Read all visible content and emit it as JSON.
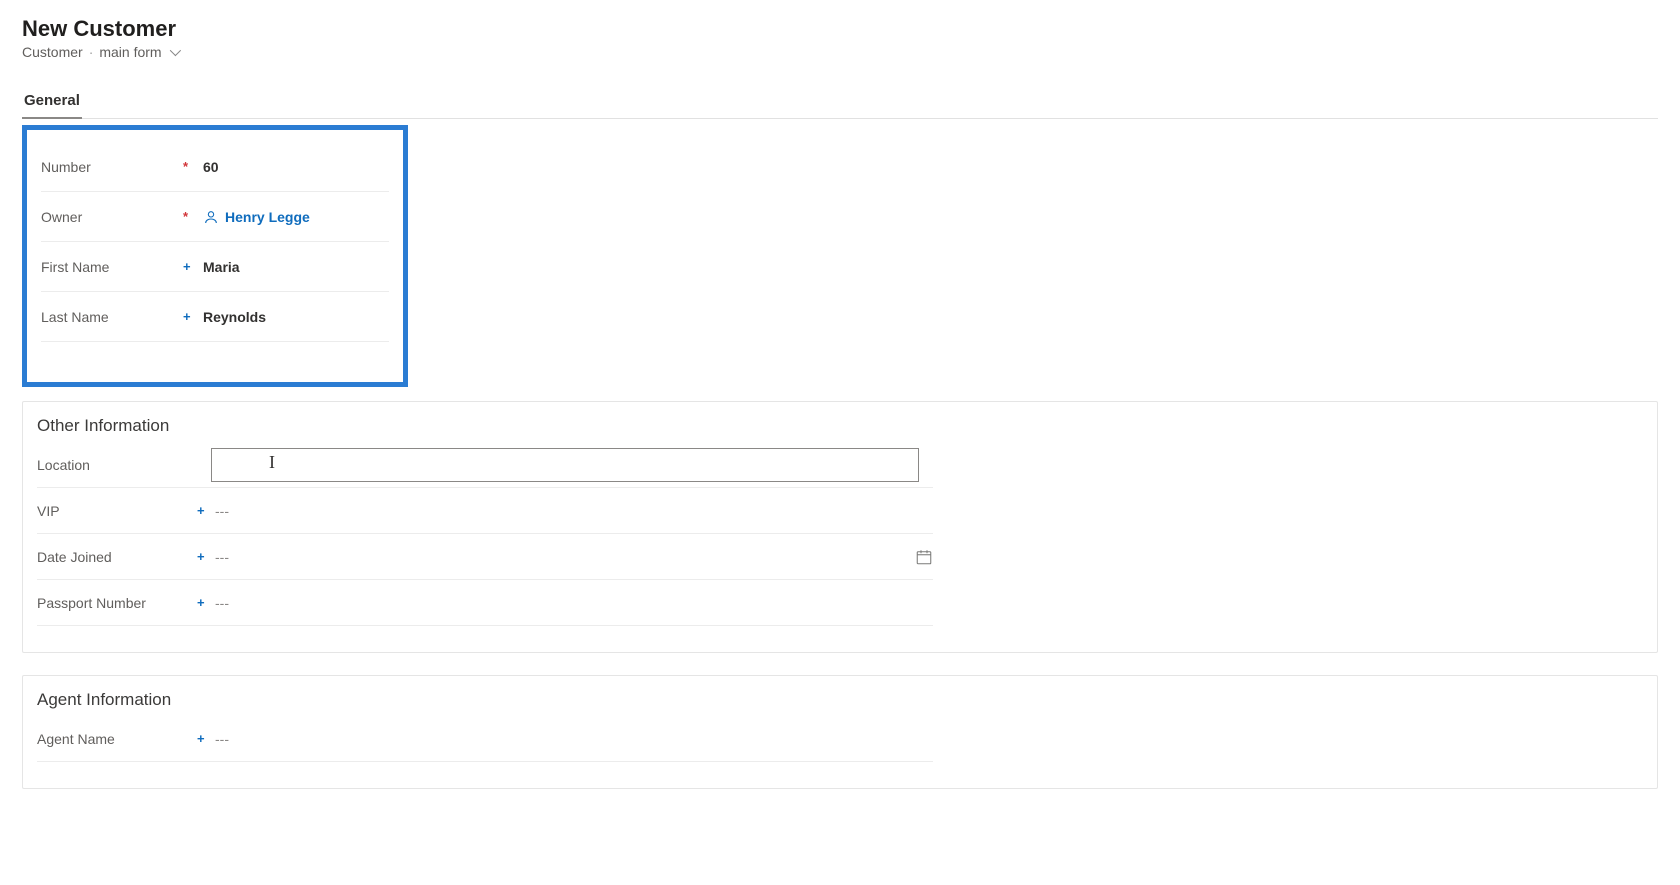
{
  "header": {
    "title": "New Customer",
    "entity": "Customer",
    "form_name": "main form"
  },
  "tabs": {
    "general": "General"
  },
  "general_section": {
    "fields": {
      "number": {
        "label": "Number",
        "value": "60"
      },
      "owner": {
        "label": "Owner",
        "value": "Henry Legge"
      },
      "first_name": {
        "label": "First Name",
        "value": "Maria"
      },
      "last_name": {
        "label": "Last Name",
        "value": "Reynolds"
      }
    }
  },
  "other_info": {
    "title": "Other Information",
    "fields": {
      "location": {
        "label": "Location",
        "value": ""
      },
      "vip": {
        "label": "VIP",
        "value": "---"
      },
      "date_joined": {
        "label": "Date Joined",
        "value": "---"
      },
      "passport_number": {
        "label": "Passport Number",
        "value": "---"
      }
    }
  },
  "agent_info": {
    "title": "Agent Information",
    "fields": {
      "agent_name": {
        "label": "Agent Name",
        "value": "---"
      }
    }
  },
  "placeholders": {
    "empty": "---"
  }
}
